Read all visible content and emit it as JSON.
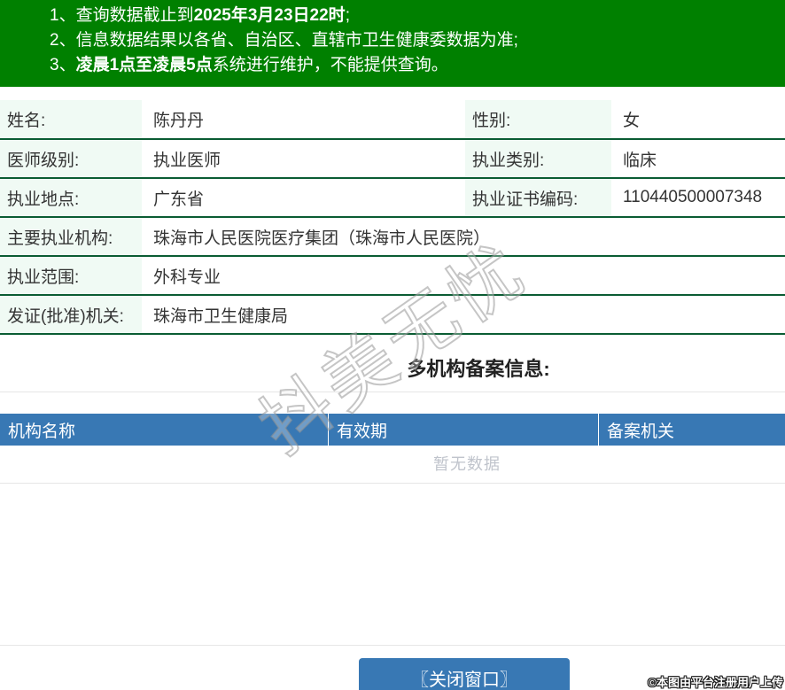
{
  "banner": {
    "notices": [
      {
        "prefix": "1、查询数据截止到",
        "bold": "2025年3月23日22时",
        "suffix": ";"
      },
      {
        "prefix": "2、信息数据结果以各省、自治区、直辖市卫生健康委数据为准;",
        "bold": "",
        "suffix": ""
      },
      {
        "prefix": "3、",
        "bold": "凌晨1点至凌晨5点",
        "suffix": "系统进行维护，不能提供查询。"
      }
    ]
  },
  "detail": {
    "rows_two_col": [
      {
        "label1": "姓名:",
        "value1": "陈丹丹",
        "label2": "性别:",
        "value2": "女"
      },
      {
        "label1": "医师级别:",
        "value1": "执业医师",
        "label2": "执业类别:",
        "value2": "临床"
      },
      {
        "label1": "执业地点:",
        "value1": "广东省",
        "label2": "执业证书编码:",
        "value2": "110440500007348"
      }
    ],
    "rows_full": [
      {
        "label": "主要执业机构:",
        "value": "珠海市人民医院医疗集团（珠海市人民医院）"
      },
      {
        "label": "执业范围:",
        "value": "外科专业"
      },
      {
        "label": "发证(批准)机关:",
        "value": "珠海市卫生健康局"
      }
    ]
  },
  "multi_org": {
    "title": "多机构备案信息:",
    "columns": [
      "机构名称",
      "有效期",
      "备案机关"
    ],
    "empty_text": "暂无数据"
  },
  "watermark": {
    "text": "抖美无忧"
  },
  "footer": {
    "close_button": "〖关闭窗口〗",
    "copyright": "©本图由平台注册用户上传"
  },
  "colors": {
    "banner_green": "#008000",
    "row_border_green": "#0a5c33",
    "label_bg_mint": "#f0faf4",
    "header_blue": "#3878b4",
    "button_blue": "#3878b4",
    "empty_text_gray": "#c0c4cc",
    "divider_gray": "#e6e6e6"
  }
}
